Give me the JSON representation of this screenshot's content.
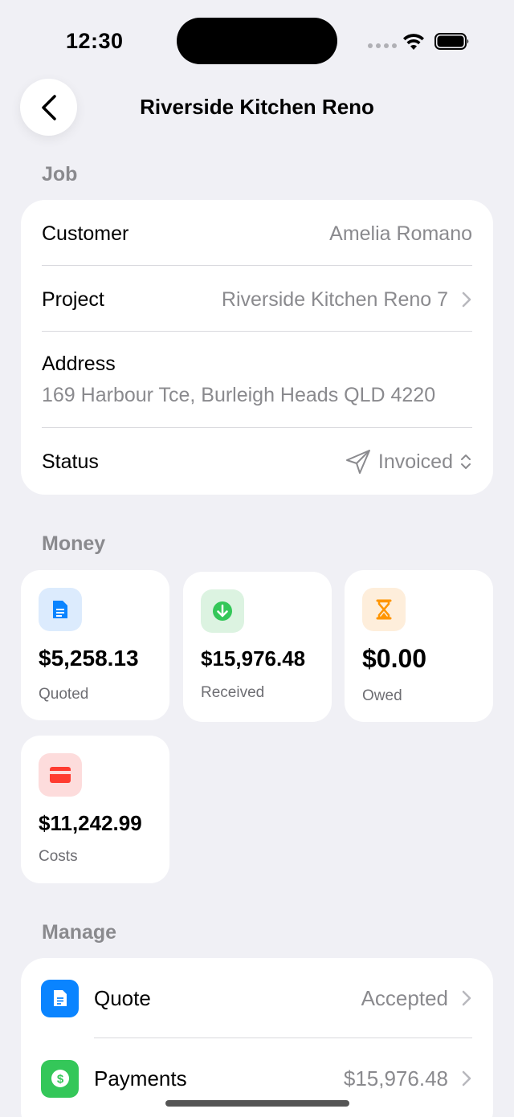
{
  "status_bar": {
    "time": "12:30"
  },
  "nav": {
    "title": "Riverside Kitchen Reno"
  },
  "job": {
    "section": "Job",
    "customer_label": "Customer",
    "customer_value": "Amelia Romano",
    "project_label": "Project",
    "project_value": "Riverside Kitchen Reno 7",
    "address_label": "Address",
    "address_value": "169 Harbour Tce, Burleigh Heads QLD 4220",
    "status_label": "Status",
    "status_value": "Invoiced"
  },
  "money": {
    "section": "Money",
    "cards": [
      {
        "amount": "$5,258.13",
        "label": "Quoted",
        "icon": "document-icon",
        "color": "#0a84ff"
      },
      {
        "amount": "$15,976.48",
        "label": "Received",
        "icon": "arrow-down-circle-icon",
        "color": "#34c759"
      },
      {
        "amount": "$0.00",
        "label": "Owed",
        "icon": "hourglass-icon",
        "color": "#ff9500"
      },
      {
        "amount": "$11,242.99",
        "label": "Costs",
        "icon": "credit-card-icon",
        "color": "#ff3b30"
      }
    ]
  },
  "manage": {
    "section": "Manage",
    "rows": [
      {
        "label": "Quote",
        "value": "Accepted",
        "icon": "document-icon",
        "color": "#0a84ff"
      },
      {
        "label": "Payments",
        "value": "$15,976.48",
        "icon": "dollar-circle-icon",
        "color": "#34c759"
      }
    ]
  }
}
